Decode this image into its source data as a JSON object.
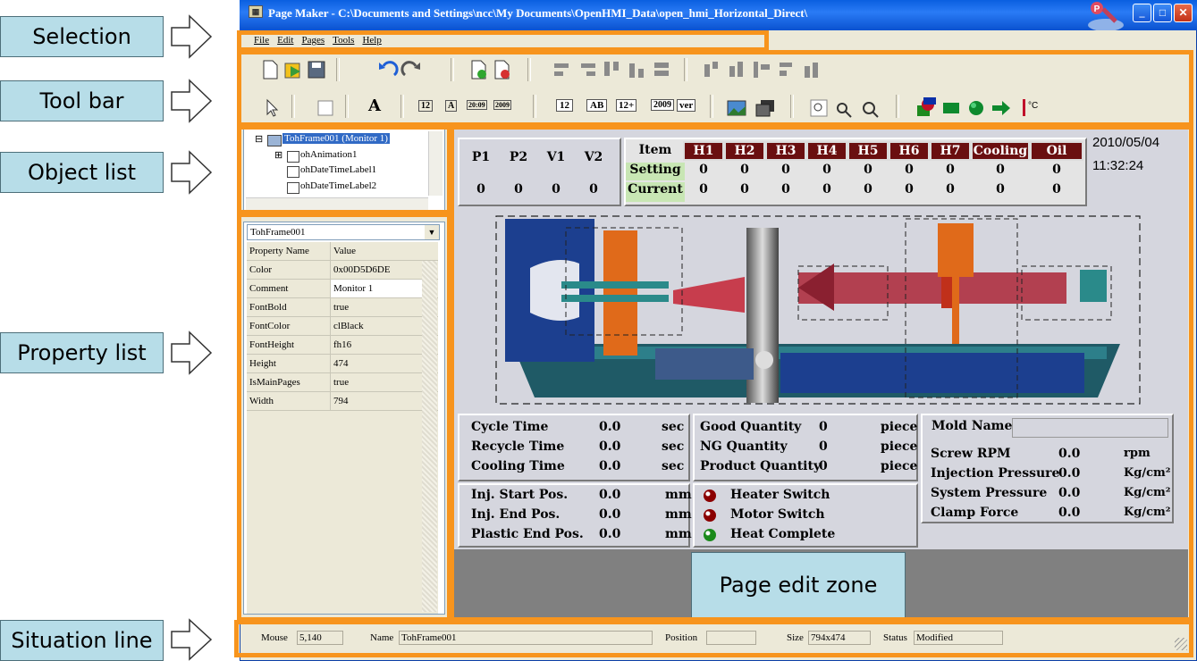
{
  "window": {
    "title": "Page Maker - C:\\Documents and Settings\\ncc\\My Documents\\OpenHMI_Data\\open_hmi_Horizontal_Direct\\"
  },
  "callouts": {
    "selection": "Selection",
    "toolbar": "Tool bar",
    "object_list": "Object list",
    "property_list": "Property list",
    "situation_line": "Situation line",
    "page_edit_zone": "Page edit zone"
  },
  "menu": [
    "File",
    "Edit",
    "Pages",
    "Tools",
    "Help"
  ],
  "toolbar2": {
    "text_tool": "A",
    "t1": "12",
    "t2": "A",
    "t3": "20:09",
    "t4": "2009",
    "b1": "12",
    "b2": "AB",
    "b3": "12+",
    "b4": "2009",
    "b5": "ver",
    "temp": "°C"
  },
  "object_tree": [
    {
      "label": "TohFrame001 (Monitor 1)",
      "expander": "⊟",
      "selected": true
    },
    {
      "label": "ohAnimation1",
      "expander": "⊞"
    },
    {
      "label": "ohDateTimeLabel1",
      "expander": ""
    },
    {
      "label": "ohDateTimeLabel2",
      "expander": ""
    }
  ],
  "property_list": {
    "object_select": "TohFrame001",
    "col_name": "Property Name",
    "col_value": "Value",
    "rows": [
      {
        "name": "Color",
        "value": "0x00D5D6DE"
      },
      {
        "name": "Comment",
        "value": "Monitor 1"
      },
      {
        "name": "FontBold",
        "value": "true"
      },
      {
        "name": "FontColor",
        "value": "clBlack"
      },
      {
        "name": "FontHeight",
        "value": "fh16"
      },
      {
        "name": "Height",
        "value": "474"
      },
      {
        "name": "IsMainPages",
        "value": "true"
      },
      {
        "name": "Width",
        "value": "794"
      }
    ]
  },
  "hmi": {
    "pv_headers": [
      "P1",
      "P2",
      "V1",
      "V2"
    ],
    "pv_values": [
      "0",
      "0",
      "0",
      "0"
    ],
    "temp_item": "Item",
    "temp_headers": [
      "H1",
      "H2",
      "H3",
      "H4",
      "H5",
      "H6",
      "H7",
      "Cooling",
      "Oil"
    ],
    "setting_label": "Setting",
    "current_label": "Current",
    "setting_values": [
      "0",
      "0",
      "0",
      "0",
      "0",
      "0",
      "0",
      "0",
      "0"
    ],
    "current_values": [
      "0",
      "0",
      "0",
      "0",
      "0",
      "0",
      "0",
      "0",
      "0"
    ],
    "date": "2010/05/04",
    "time": "11:32:24",
    "times": [
      {
        "label": "Cycle Time",
        "value": "0.0",
        "unit": "sec"
      },
      {
        "label": "Recycle Time",
        "value": "0.0",
        "unit": "sec"
      },
      {
        "label": "Cooling Time",
        "value": "0.0",
        "unit": "sec"
      }
    ],
    "quantities": [
      {
        "label": "Good Quantity",
        "value": "0",
        "unit": "piece"
      },
      {
        "label": "NG Quantity",
        "value": "0",
        "unit": "piece"
      },
      {
        "label": "Product Quantity",
        "value": "0",
        "unit": "piece"
      }
    ],
    "positions": [
      {
        "label": "Inj. Start Pos.",
        "value": "0.0",
        "unit": "mm"
      },
      {
        "label": "Inj. End Pos.",
        "value": "0.0",
        "unit": "mm"
      },
      {
        "label": "Plastic End Pos.",
        "value": "0.0",
        "unit": "mm"
      }
    ],
    "switches": [
      {
        "label": "Heater Switch",
        "color": "#8b0000"
      },
      {
        "label": "Motor Switch",
        "color": "#8b0000"
      },
      {
        "label": "Heat Complete",
        "color": "#1a8a1a"
      }
    ],
    "mold_name_label": "Mold Name",
    "mold_name_value": "",
    "mold": [
      {
        "label": "Screw RPM",
        "value": "0.0",
        "unit": "rpm"
      },
      {
        "label": "Injection Pressure",
        "value": "0.0",
        "unit": "Kg/cm²"
      },
      {
        "label": "System Pressure",
        "value": "0.0",
        "unit": "Kg/cm²"
      },
      {
        "label": "Clamp Force",
        "value": "0.0",
        "unit": "Kg/cm²"
      }
    ]
  },
  "status": {
    "mouse_label": "Mouse",
    "mouse_value": "5,140",
    "name_label": "Name",
    "name_value": "TohFrame001",
    "position_label": "Position",
    "position_value": "",
    "size_label": "Size",
    "size_value": "794x474",
    "status_label": "Status",
    "status_value": "Modified"
  },
  "colors": {
    "accent": "#f7941d",
    "callout": "#b7dde8",
    "canvas": "#d5d6de",
    "header_red": "#6a0f10",
    "setting_green": "#c8e6b4"
  }
}
